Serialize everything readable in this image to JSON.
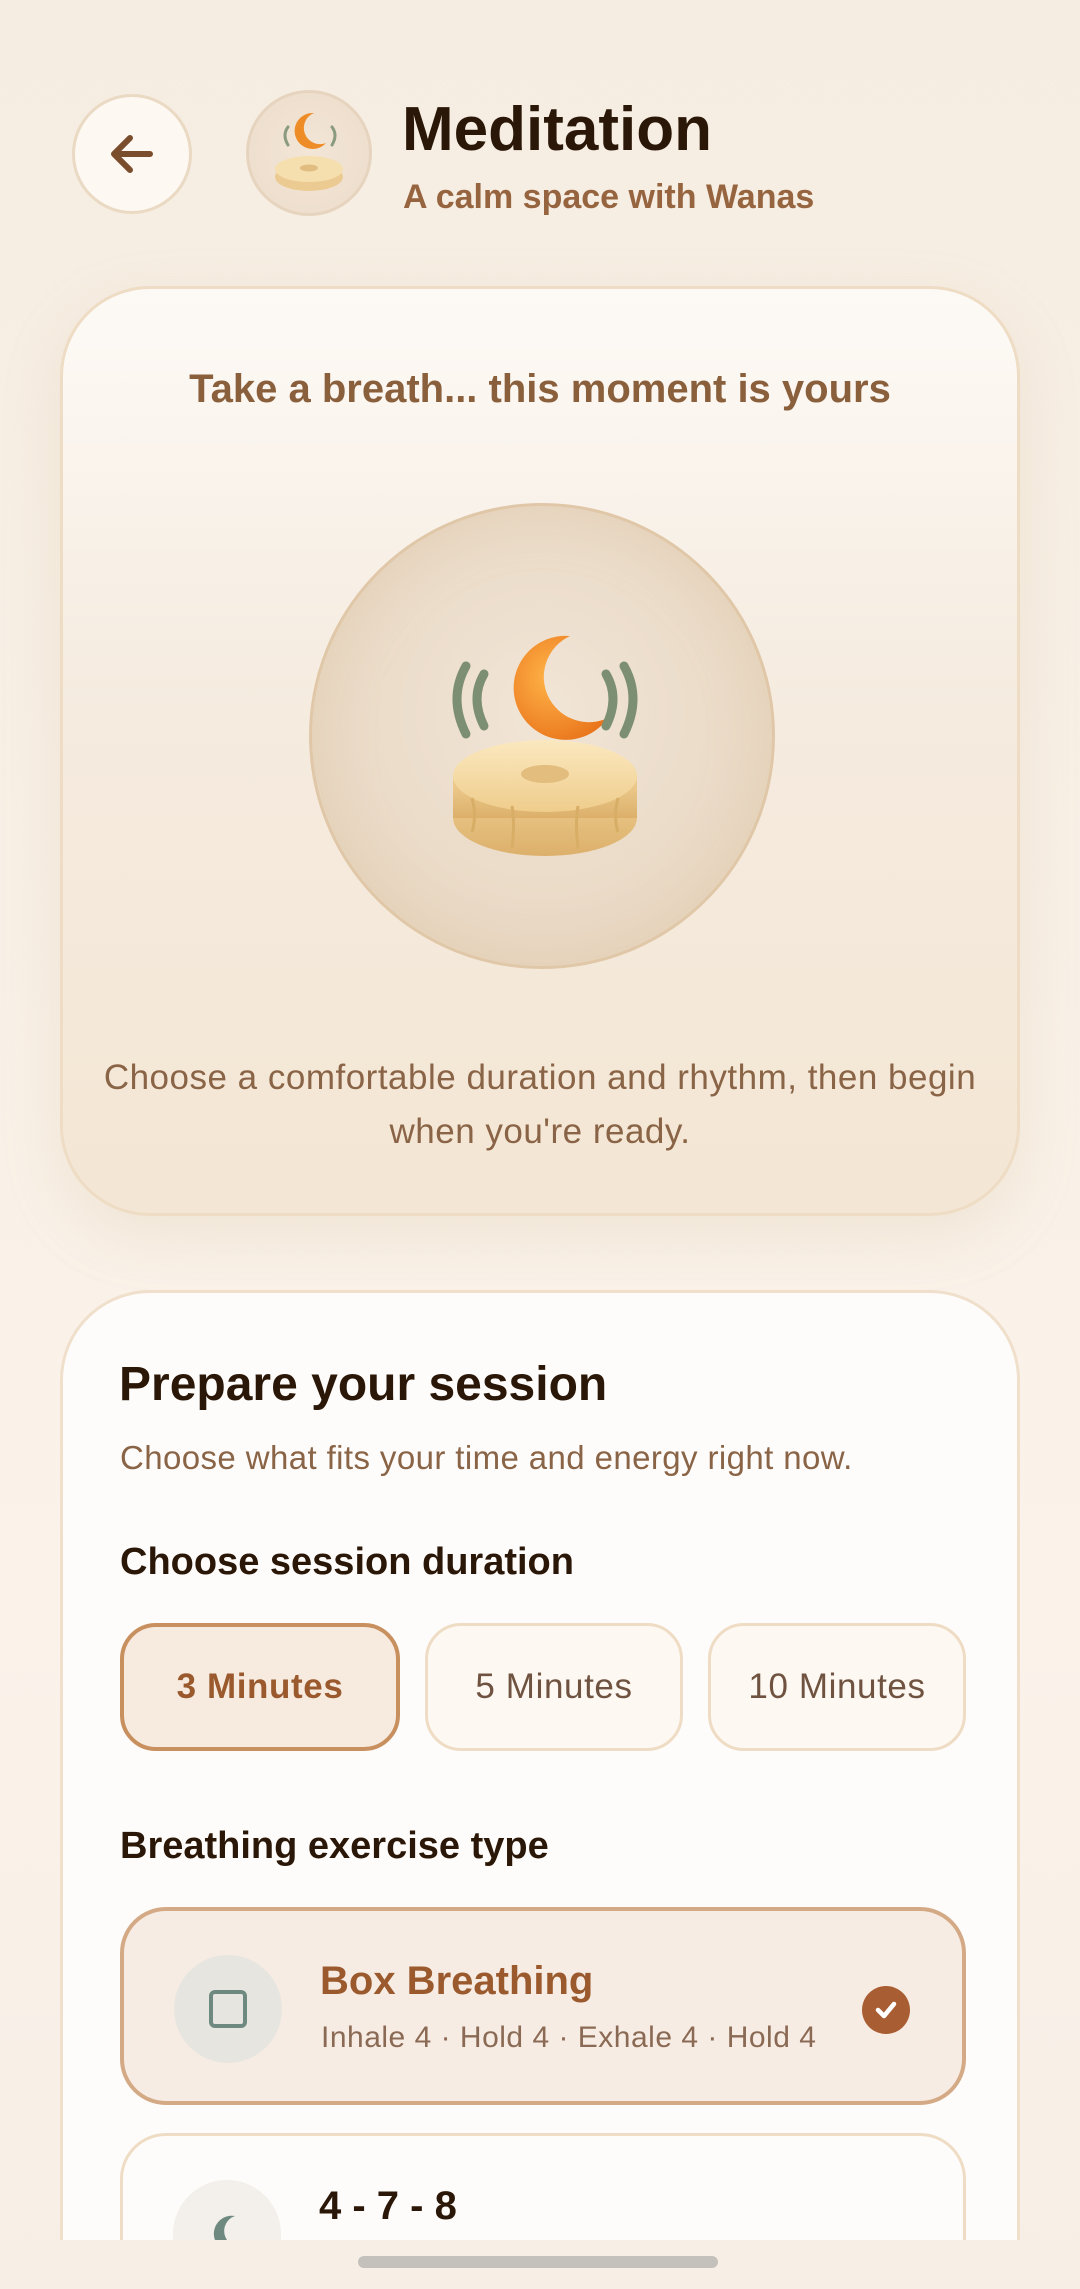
{
  "header": {
    "back_icon": "arrow-left-icon",
    "avatar_icon": "meditation-cushion-moon-icon",
    "title": "Meditation",
    "subtitle": "A calm space with Wanas"
  },
  "hero": {
    "title": "Take a breath... this moment is yours",
    "illustration": "meditation-cushion-moon-icon",
    "description": "Choose a comfortable duration and rhythm, then begin when you're ready."
  },
  "session": {
    "title": "Prepare your session",
    "subtitle": "Choose what fits your time and energy right now.",
    "duration_label": "Choose session duration",
    "durations": [
      {
        "label": "3 Minutes",
        "selected": true
      },
      {
        "label": "5 Minutes",
        "selected": false
      },
      {
        "label": "10 Minutes",
        "selected": false
      }
    ],
    "exercise_label": "Breathing exercise type",
    "exercises": [
      {
        "name": "Box Breathing",
        "detail": "Inhale 4 · Hold 4 · Exhale 4 · Hold 4",
        "icon": "square-icon",
        "selected": true
      },
      {
        "name": "4 - 7 - 8",
        "detail": "",
        "icon": "moon-icon",
        "selected": false
      }
    ]
  },
  "colors": {
    "accent": "#a95d32",
    "accent_border": "#c9905f",
    "background": "#f6ede2",
    "title_text": "#2b1707",
    "muted_text": "#8a6446"
  }
}
